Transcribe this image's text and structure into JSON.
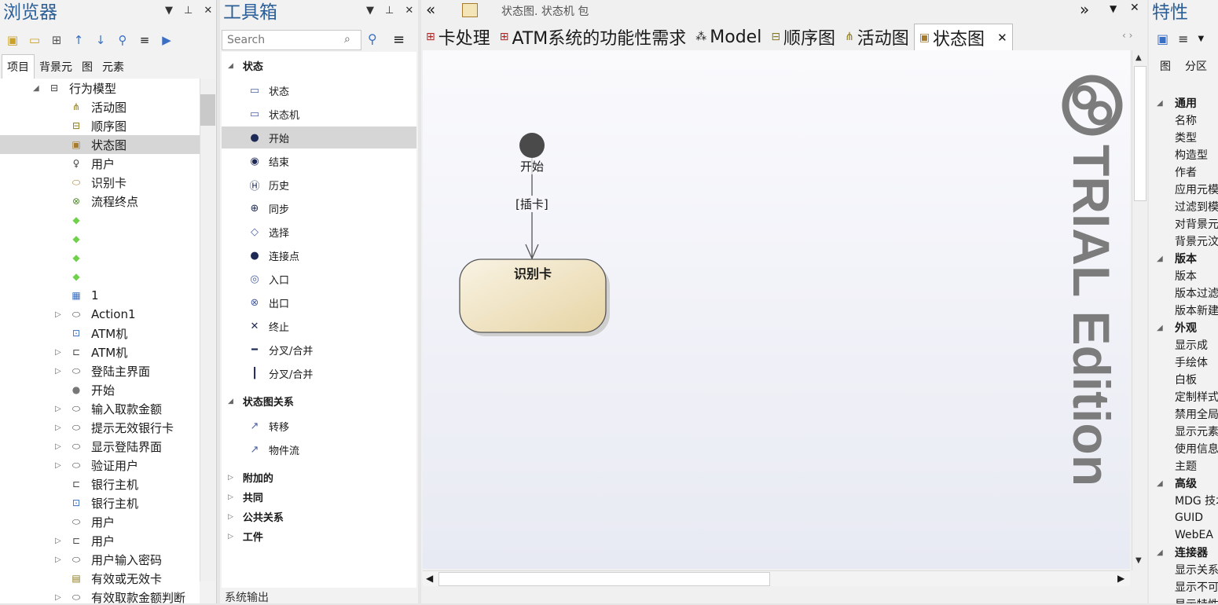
{
  "browser": {
    "title": "浏览器",
    "tabs": [
      "项目",
      "背景元",
      "图",
      "元素"
    ],
    "items": [
      {
        "label": "行为模型",
        "icon": "package-icon"
      },
      {
        "label": "活动图",
        "icon": "activity-diagram-icon"
      },
      {
        "label": "顺序图",
        "icon": "sequence-diagram-icon"
      },
      {
        "label": "状态图",
        "icon": "state-diagram-icon"
      },
      {
        "label": "用户",
        "icon": "actor-icon"
      },
      {
        "label": "识别卡",
        "icon": "state-icon"
      },
      {
        "label": "流程终点",
        "icon": "flow-final-icon"
      },
      {
        "label": "",
        "icon": "decision-icon"
      },
      {
        "label": "",
        "icon": "decision-icon"
      },
      {
        "label": "",
        "icon": "decision-icon"
      },
      {
        "label": "",
        "icon": "decision-icon"
      },
      {
        "label": "1",
        "icon": "calculator-icon"
      },
      {
        "label": "Action1",
        "icon": "action-icon"
      },
      {
        "label": "ATM机",
        "icon": "screen-icon"
      },
      {
        "label": "ATM机",
        "icon": "class-icon"
      },
      {
        "label": "登陆主界面",
        "icon": "action-icon"
      },
      {
        "label": "开始",
        "icon": "initial-icon"
      },
      {
        "label": "输入取款金额",
        "icon": "action-icon"
      },
      {
        "label": "提示无效银行卡",
        "icon": "action-icon"
      },
      {
        "label": "显示登陆界面",
        "icon": "action-icon"
      },
      {
        "label": "验证用户",
        "icon": "action-icon"
      },
      {
        "label": "银行主机",
        "icon": "class-icon"
      },
      {
        "label": "银行主机",
        "icon": "screen-icon"
      },
      {
        "label": "用户",
        "icon": "action-icon"
      },
      {
        "label": "用户",
        "icon": "class-icon"
      },
      {
        "label": "用户输入密码",
        "icon": "action-icon"
      },
      {
        "label": "有效或无效卡",
        "icon": "note-icon"
      },
      {
        "label": "有效取款金额判断",
        "icon": "action-icon"
      }
    ]
  },
  "toolbox": {
    "title": "工具箱",
    "search_placeholder": "Search",
    "groups": [
      {
        "label": "状态"
      },
      {
        "label": "状态图关系"
      },
      {
        "label": "附加的"
      },
      {
        "label": "共同"
      },
      {
        "label": "公共关系"
      },
      {
        "label": "工件"
      }
    ],
    "state_tools": [
      "状态",
      "状态机",
      "开始",
      "结束",
      "历史",
      "同步",
      "选择",
      "连接点",
      "入口",
      "出口",
      "终止",
      "分叉/合并",
      "分叉/合并"
    ],
    "relation_tools": [
      "转移",
      "物件流"
    ],
    "bottom_label": "系统输出"
  },
  "diagram": {
    "breadcrumb": "状态图.  状态机 包",
    "tabs": [
      "卡处理",
      "ATM系统的功能性需求",
      "Model",
      "顺序图",
      "活动图",
      "状态图"
    ],
    "initial_label": "开始",
    "guard_label": "[插卡]",
    "state_label": "识别卡",
    "watermark": "TRIAL Edition"
  },
  "properties": {
    "title": "特性",
    "tabs": [
      "图",
      "分区"
    ],
    "rows": [
      {
        "label": "通用",
        "section": true
      },
      {
        "label": "名称"
      },
      {
        "label": "类型"
      },
      {
        "label": "构造型"
      },
      {
        "label": "作者"
      },
      {
        "label": "应用元模"
      },
      {
        "label": "过滤到模"
      },
      {
        "label": "对背景元"
      },
      {
        "label": "背景元汶"
      },
      {
        "label": "版本",
        "section": true
      },
      {
        "label": "版本"
      },
      {
        "label": "版本过滤"
      },
      {
        "label": "版本新建"
      },
      {
        "label": "外观",
        "section": true
      },
      {
        "label": "显示成"
      },
      {
        "label": "手绘体"
      },
      {
        "label": "白板"
      },
      {
        "label": "定制样式"
      },
      {
        "label": "禁用全局"
      },
      {
        "label": "显示元素"
      },
      {
        "label": "使用信息"
      },
      {
        "label": "主题"
      },
      {
        "label": "高级",
        "section": true
      },
      {
        "label": "MDG 技术"
      },
      {
        "label": "GUID"
      },
      {
        "label": "WebEA"
      },
      {
        "label": "连接器",
        "section": true
      },
      {
        "label": "显示关系"
      },
      {
        "label": "显示不可"
      },
      {
        "label": "显示特性"
      }
    ]
  },
  "colors": {
    "accent": "#2c5f97",
    "state_fill": "#efe3c2",
    "selection": "#d6d6d6"
  }
}
